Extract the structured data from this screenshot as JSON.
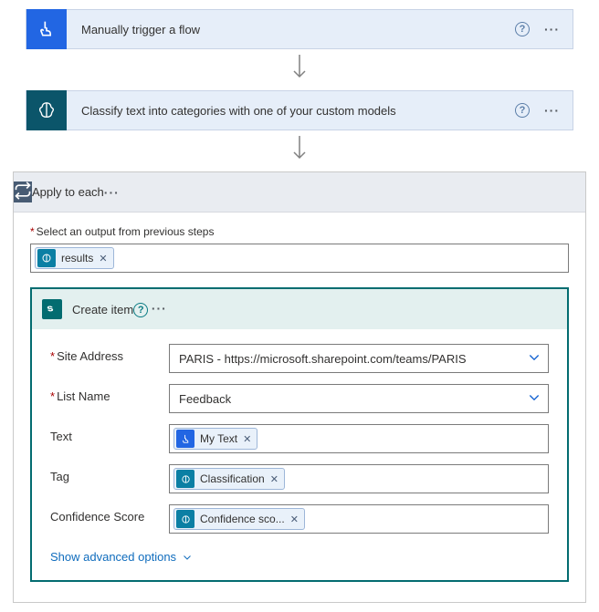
{
  "steps": {
    "manual": {
      "title": "Manually trigger a flow"
    },
    "classify": {
      "title": "Classify text into categories with one of your custom models"
    },
    "apply": {
      "title": "Apply to each"
    },
    "create": {
      "title": "Create item"
    }
  },
  "apply": {
    "select_output_label": "Select an output from previous steps",
    "output_token": "results"
  },
  "create_item": {
    "rows": {
      "site": {
        "label": "Site Address",
        "required": true,
        "value": "PARIS - https://microsoft.sharepoint.com/teams/PARIS"
      },
      "list": {
        "label": "List Name",
        "required": true,
        "value": "Feedback"
      },
      "text": {
        "label": "Text",
        "token": "My Text"
      },
      "tag": {
        "label": "Tag",
        "token": "Classification"
      },
      "conf": {
        "label": "Confidence Score",
        "token": "Confidence sco..."
      }
    },
    "advanced": "Show advanced options"
  }
}
